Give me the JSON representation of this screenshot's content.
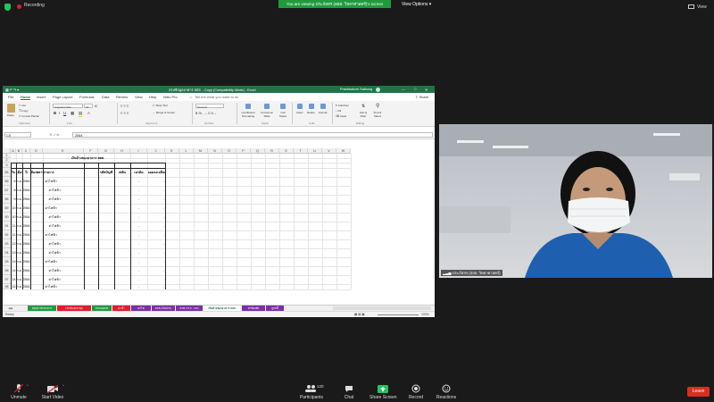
{
  "zoom": {
    "recording_label": "Recording",
    "viewing_banner": "You are viewing ประภัสสร (สสส. วิทยาศาสตร์)'s screen",
    "view_options": "View Options",
    "view_label": "View",
    "colors": {
      "banner_green": "#1f9b3d",
      "recording_red": "#e11d2e",
      "leave_red": "#d92d20"
    },
    "controls": [
      {
        "label": "Unmute",
        "icon": "mic-muted-icon"
      },
      {
        "label": "Start Video",
        "icon": "video-off-icon"
      },
      {
        "label": "Participants",
        "icon": "participants-icon",
        "count": "120"
      },
      {
        "label": "Chat",
        "icon": "chat-icon"
      },
      {
        "label": "Share Screen",
        "icon": "share-screen-icon"
      },
      {
        "label": "Record",
        "icon": "record-icon"
      },
      {
        "label": "Reactions",
        "icon": "reactions-icon"
      }
    ],
    "leave_label": "Leave",
    "video_participant_name": "ประภัสสร (สสส. วิทยาศาสตร์)"
  },
  "excel": {
    "window_title": "สรุปข้อมูลอาคาร สสส. - Copy (Compatibility Mode) - Excel",
    "user_name": "Prasitsakorn Saiboog",
    "menu_tabs": [
      "File",
      "Home",
      "Insert",
      "Page Layout",
      "Formulas",
      "Data",
      "Review",
      "View",
      "Help",
      "Nitro Pro"
    ],
    "active_tab": "Home",
    "tell_me": "Tell me what you want to do",
    "share_label": "Share",
    "ribbon": {
      "clipboard": {
        "cut": "Cut",
        "copy": "Copy",
        "format_painter": "Format Painter",
        "paste": "Paste",
        "group": "Clipboard"
      },
      "font": {
        "font_name": "Angsana New",
        "font_size": "16",
        "group": "Font"
      },
      "alignment": {
        "wrap_text": "Wrap Text",
        "merge_center": "Merge & Center",
        "group": "Alignment"
      },
      "number": {
        "format": "General",
        "group": "Number"
      },
      "styles": {
        "conditional": "Conditional Formatting",
        "format_table": "Format as Table",
        "cell_styles": "Cell Styles",
        "group": "Styles"
      },
      "cells": {
        "insert": "Insert",
        "delete": "Delete",
        "format": "Format",
        "group": "Cells"
      },
      "editing": {
        "autosum": "AutoSum",
        "fill": "Fill",
        "clear": "Clear",
        "sort_filter": "Sort & Filter",
        "find_select": "Find & Select",
        "group": "Editing"
      }
    },
    "name_box": "C5",
    "formula_value": "2564",
    "columns": [
      "A",
      "B",
      "C",
      "D",
      "E",
      "F",
      "G",
      "H",
      "I",
      "J",
      "K",
      "L",
      "M",
      "N",
      "O",
      "P",
      "Q",
      "R",
      "S",
      "T",
      "U",
      "V",
      "W"
    ],
    "sheet_title": "เงินค้างของอาคาร สสส.",
    "headers": [
      "วัน",
      "เดือน",
      "ปี",
      "ห้องพสาร",
      "รายการ",
      "รหัสบัญชี",
      "เพลิน",
      "เครดิต",
      "ยอดคงเหลือยกไป"
    ],
    "row_numbers": [
      "1",
      "2",
      "3",
      "85",
      "86",
      "87",
      "88",
      "89",
      "90",
      "91",
      "92",
      "93",
      "94",
      "95",
      "96",
      "97",
      "98"
    ],
    "rows": [
      {
        "d": "6",
        "m": "ก.ย.",
        "y": "2564",
        "e": "",
        "f": "ค่าไฟฟ้า",
        "h": "",
        "i": "-",
        "j": "-"
      },
      {
        "d": "8",
        "m": "ก.ย.",
        "y": "2564",
        "e": "",
        "f": "ค่าไฟฟ้า",
        "h": "",
        "i": "-",
        "j": "-"
      },
      {
        "d": "9",
        "m": "ก.ย.",
        "y": "2564",
        "e": "",
        "f": "ค่าไฟฟ้า",
        "h": "",
        "i": "-",
        "j": "-"
      },
      {
        "d": "10",
        "m": "ก.ย.",
        "y": "2564",
        "e": "",
        "f": "ค่าไฟฟ้า",
        "h": "",
        "i": "-",
        "j": "-"
      },
      {
        "d": "10",
        "m": "ก.ย.",
        "y": "2564",
        "e": "",
        "f": "ค่าไฟฟ้า",
        "h": "",
        "i": "-",
        "j": "-"
      },
      {
        "d": "11",
        "m": "ก.ย.",
        "y": "2564",
        "e": "",
        "f": "ค่าไฟฟ้า",
        "h": "",
        "i": "-",
        "j": "-"
      },
      {
        "d": "11",
        "m": "ก.ย.",
        "y": "2564",
        "e": "",
        "f": "ค่าไฟฟ้า",
        "h": "",
        "i": "-",
        "j": "-"
      },
      {
        "d": "12",
        "m": "ก.ย.",
        "y": "2564",
        "e": "",
        "f": "ค่าไฟฟ้า",
        "h": "",
        "i": "-",
        "j": "-"
      },
      {
        "d": "13",
        "m": "ก.ย.",
        "y": "2564",
        "e": "",
        "f": "ค่าไฟฟ้า",
        "h": "",
        "i": "-",
        "j": "-"
      },
      {
        "d": "14",
        "m": "ก.ย.",
        "y": "2564",
        "e": "",
        "f": "ค่าไฟฟ้า",
        "h": "",
        "i": "-",
        "j": "-"
      },
      {
        "d": "14",
        "m": "ก.ย.",
        "y": "2564",
        "e": "",
        "f": "ค่าไฟฟ้า",
        "h": "",
        "i": "-",
        "j": "-"
      },
      {
        "d": "14",
        "m": "ก.ย.",
        "y": "2564",
        "e": "",
        "f": "ค่าไฟฟ้า",
        "h": "",
        "i": "-",
        "j": "-"
      },
      {
        "d": "14",
        "m": "ก.ย.",
        "y": "2564",
        "e": "",
        "f": "ค่าไฟฟ้า",
        "h": "",
        "i": "-",
        "j": "-"
      },
      {
        "d": "15",
        "m": "ก.ย.",
        "y": "2564",
        "e": "",
        "f": "ค่าไฟฟ้า",
        "h": "",
        "i": "-",
        "j": "-"
      }
    ],
    "sheet_tabs": [
      {
        "label": "สรุปค่าเช่าอาคาร",
        "color": "#1f9b3d"
      },
      {
        "label": "เช่าห้องประชุม",
        "color": "#e11d2e"
      },
      {
        "label": "ลานจอดรถ",
        "color": "#1f9b3d"
      },
      {
        "label": "ค่าน้ำ",
        "color": "#e11d2e"
      },
      {
        "label": "ค่าไฟ",
        "color": "#7b2fa8"
      },
      {
        "label": "STB (เงินฝาก)",
        "color": "#7b2fa8"
      },
      {
        "label": "STB (TTC - KK)",
        "color": "#7b2fa8"
      },
      {
        "label": "เงินค้างของอาคาร สสส.",
        "color": "#ffffff"
      },
      {
        "label": "ค่าห้องพัก",
        "color": "#7b2fa8"
      },
      {
        "label": "ลูกหนี้",
        "color": "#7b2fa8"
      }
    ],
    "status_left": "Ready",
    "zoom_level": "100%"
  }
}
